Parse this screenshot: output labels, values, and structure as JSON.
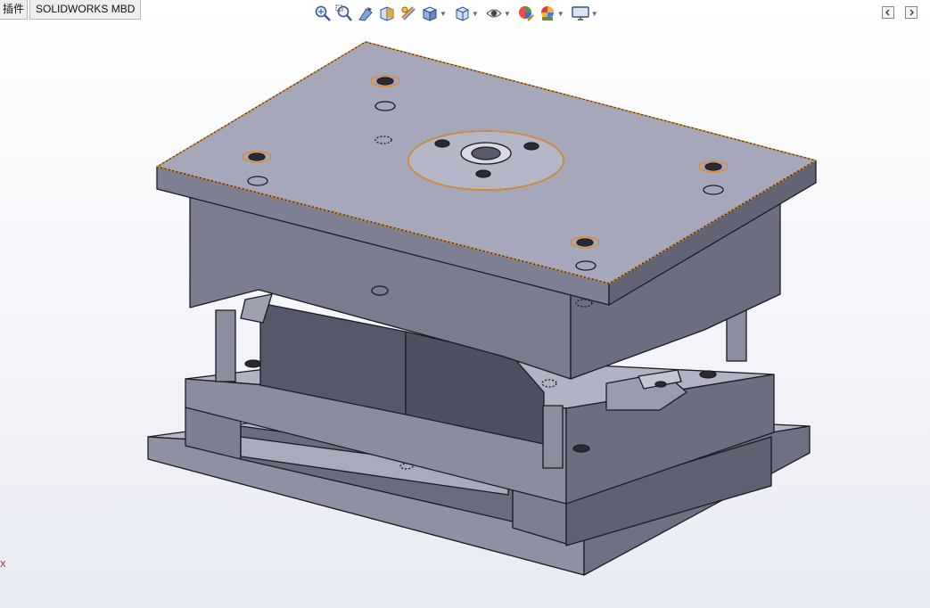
{
  "command_manager": {
    "tabs": [
      {
        "label": "插件"
      },
      {
        "label": "SOLIDWORKS MBD"
      }
    ]
  },
  "heads_up_toolbar": {
    "tools": [
      {
        "icon": "zoom-to-fit-icon"
      },
      {
        "icon": "zoom-to-area-icon"
      },
      {
        "icon": "previous-view-icon"
      },
      {
        "icon": "section-view-icon"
      },
      {
        "icon": "dynamic-annotation-views-icon"
      },
      {
        "icon": "view-orientation-icon",
        "dropdown": true
      },
      {
        "icon": "display-style-icon",
        "dropdown": true
      },
      {
        "icon": "hide-show-items-icon",
        "dropdown": true
      },
      {
        "icon": "edit-appearance-icon"
      },
      {
        "icon": "apply-scene-icon",
        "dropdown": true
      },
      {
        "icon": "view-settings-icon",
        "dropdown": true
      }
    ]
  },
  "colors": {
    "model_face_top": "#a7a8bb",
    "model_face_side": "#8b8c9e",
    "model_face_dark": "#5b5d6b",
    "edge_highlight": "#e58a1f"
  },
  "triad": {
    "axis_label": "X"
  }
}
